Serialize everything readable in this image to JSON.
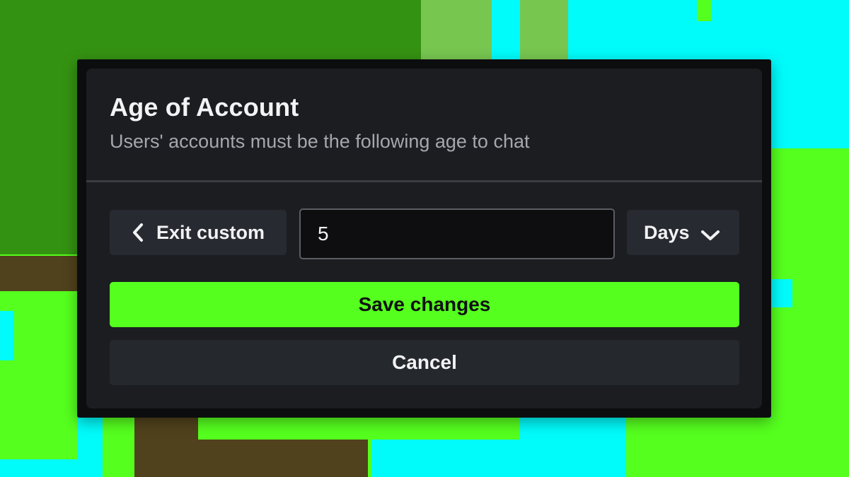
{
  "dialog": {
    "title": "Age of Account",
    "subtitle": "Users' accounts must be the following age to chat"
  },
  "controls": {
    "exit_custom_label": "Exit custom",
    "exit_custom_icon": "chevron-left-icon",
    "age_value": "5",
    "unit_selected": "Days",
    "unit_icon": "chevron-down-icon"
  },
  "actions": {
    "save_label": "Save changes",
    "cancel_label": "Cancel"
  },
  "colors": {
    "accent": "#55ff1e",
    "dialog_background": "#1b1d21",
    "backdrop_cyan": "#00fbfb",
    "backdrop_brown": "#50421c"
  }
}
